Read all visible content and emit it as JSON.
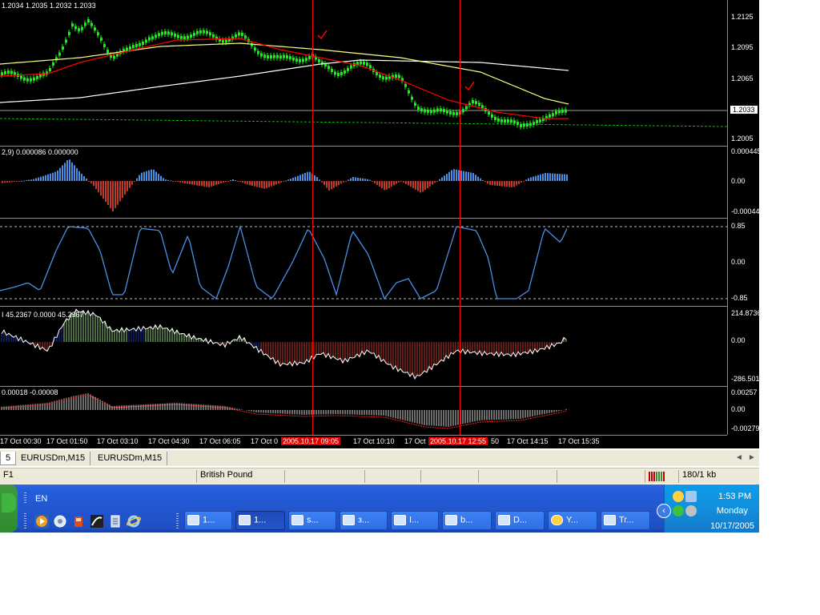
{
  "price_pane": {
    "title": "1.2034 1.2035 1.2032 1.2033",
    "axis_labels": [
      "1.2125",
      "1.2095",
      "1.2065",
      "1.2005"
    ],
    "current_price": "1.2033"
  },
  "osma_pane": {
    "title": "2,9) 0.000086 0.000000",
    "axis_labels": [
      "0.000445",
      "0.00",
      "-0.00044"
    ]
  },
  "osc_pane": {
    "axis_labels": [
      "0.85",
      "0.00",
      "-0.85"
    ]
  },
  "cci_pane": {
    "title": "I 45.2367 0.0000 45.2367",
    "axis_labels": [
      "214.8736",
      "0.00",
      "-286.501"
    ]
  },
  "macd_pane": {
    "title": "0.00018 -0.00008",
    "axis_labels": [
      "0.00257",
      "0.00",
      "-0.00279"
    ]
  },
  "time_axis": {
    "labels": [
      "17 Oct 00:30",
      "17 Oct 01:50",
      "17 Oct 03:10",
      "17 Oct 04:30",
      "17 Oct 06:05",
      "17 Oct 0",
      "17 Oct 10:10",
      "17 Oct",
      "50",
      "17 Oct 14:15",
      "17 Oct 15:35"
    ],
    "highlight_1": "2005.10.17 09:05",
    "highlight_2": "2005.10.17 12:55"
  },
  "chart_tabs": {
    "tabs": [
      "5",
      "EURUSDm,M15",
      "EURUSDm,M15"
    ],
    "scroll_left": "◄",
    "scroll_right": "►"
  },
  "status_bar": {
    "help": "F1",
    "profile": "British Pound",
    "traffic": "180/1 kb"
  },
  "taskbar": {
    "language": "EN",
    "quick_launch_icons": [
      "media-player-icon",
      "firefox-icon",
      "tool-icon",
      "metatrader-icon",
      "notepad-icon",
      "ie-icon"
    ],
    "tasks": [
      {
        "label": "1...",
        "icon": "chart-icon"
      },
      {
        "label": "1...",
        "icon": "chart-icon"
      },
      {
        "label": "s...",
        "icon": "browser-icon"
      },
      {
        "label": "з...",
        "icon": "browser-icon"
      },
      {
        "label": "I...",
        "icon": "mail-icon"
      },
      {
        "label": "b...",
        "icon": "folder-icon"
      },
      {
        "label": "D...",
        "icon": "fx-icon"
      },
      {
        "label": "Y...",
        "icon": "messenger-icon"
      },
      {
        "label": "Tr...",
        "icon": "browser-icon"
      }
    ],
    "clock": {
      "time": "1:53 PM",
      "day": "Monday",
      "date": "10/17/2005"
    }
  },
  "colors": {
    "background": "#000000",
    "candle": "#00ff00",
    "ma_red": "#ff0000",
    "ma_yellow": "#ffff80",
    "ma_white": "#ffffff",
    "histogram_up": "#4a8fe7",
    "histogram_down": "#c0392b",
    "oscillator": "#4a8fe7",
    "vertical_marker": "#ff0000"
  }
}
